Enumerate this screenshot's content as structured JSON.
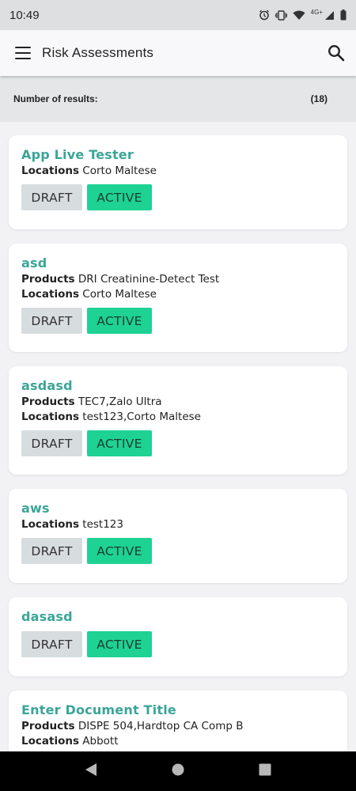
{
  "status_bar": {
    "time": "10:49",
    "network_label": "4G+",
    "icons": [
      "alarm-icon",
      "vibrate-icon",
      "wifi-icon",
      "signal-icon",
      "battery-icon"
    ]
  },
  "app_bar": {
    "title": "Risk Assessments",
    "menu_icon": "hamburger-menu-icon",
    "search_icon": "search-icon"
  },
  "results": {
    "label": "Number of results:",
    "count": "(18)"
  },
  "colors": {
    "title_teal": "#3aa597",
    "active_green": "#1ed293",
    "draft_gray": "#d7dcdf"
  },
  "items": [
    {
      "title": "App Live Tester",
      "locations_label": "Locations",
      "locations": "Corto Maltese",
      "draft": "DRAFT",
      "active": "ACTIVE"
    },
    {
      "title": "asd",
      "products_label": "Products",
      "products": "DRI Creatinine-Detect Test",
      "locations_label": "Locations",
      "locations": "Corto Maltese",
      "draft": "DRAFT",
      "active": "ACTIVE"
    },
    {
      "title": "asdasd",
      "products_label": "Products",
      "products": "TEC7,Zalo Ultra",
      "locations_label": "Locations",
      "locations": "test123,Corto Maltese",
      "draft": "DRAFT",
      "active": "ACTIVE"
    },
    {
      "title": "aws",
      "locations_label": "Locations",
      "locations": "test123",
      "draft": "DRAFT",
      "active": "ACTIVE"
    },
    {
      "title": "dasasd",
      "draft": "DRAFT",
      "active": "ACTIVE"
    },
    {
      "title": "Enter Document Title",
      "products_label": "Products",
      "products": "DISPE 504,Hardtop CA Comp B",
      "locations_label": "Locations",
      "locations": "Abbott"
    }
  ]
}
